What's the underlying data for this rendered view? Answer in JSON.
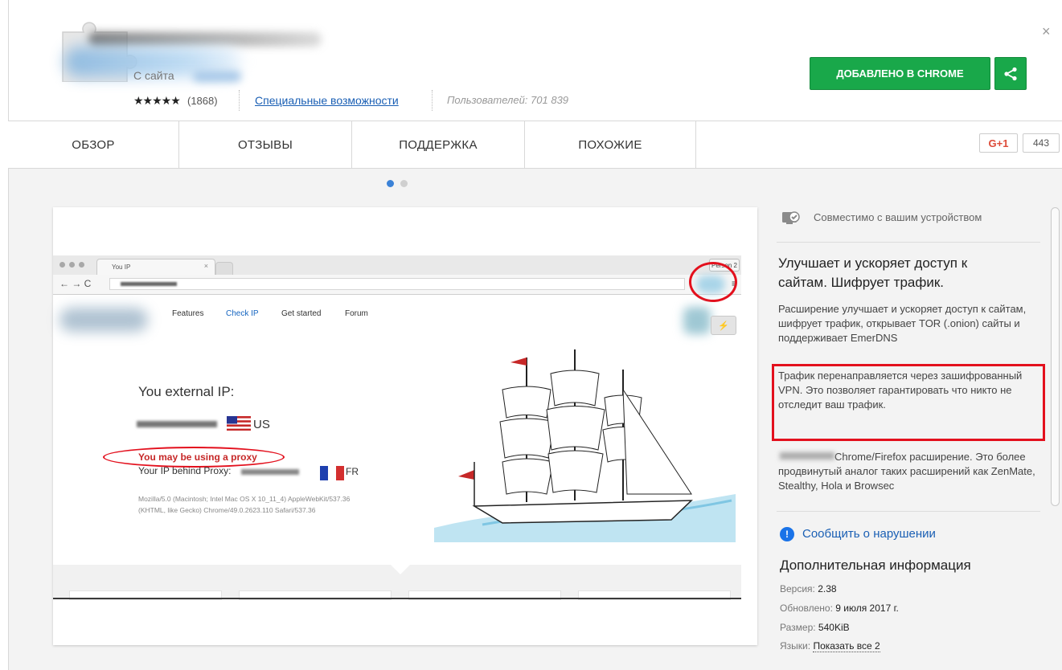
{
  "header": {
    "from_site_label": "С сайта",
    "rating_stars": "★★★★★",
    "rating_count": "(1868)",
    "category_link": "Специальные возможности",
    "users_label": "Пользователей: 701 839",
    "added_button": "ДОБАВЛЕНО В CHROME",
    "close_icon": "×"
  },
  "tabs": [
    {
      "label": "ОБЗОР"
    },
    {
      "label": "ОТЗЫВЫ"
    },
    {
      "label": "ПОДДЕРЖКА"
    },
    {
      "label": "ПОХОЖИЕ"
    }
  ],
  "social": {
    "gplus_label": "G+1",
    "gplus_count": "443"
  },
  "carousel": {
    "active_index": 0,
    "count": 2
  },
  "screenshot": {
    "browser_tab_title": "You IP",
    "browser_profile": "Person 2",
    "site_nav": [
      "Features",
      "Check IP",
      "Get started",
      "Forum"
    ],
    "ip_heading": "You external IP:",
    "country_label": "US",
    "proxy_warning": "You may be using a proxy",
    "proxy_line": "Your IP behind Proxy:",
    "proxy_country": "FR",
    "ua_line_1": "Mozilla/5.0 (Macintosh; Intel Mac OS X 10_11_4) AppleWebKit/537.36",
    "ua_line_2": "(KHTML, like Gecko) Chrome/49.0.2623.110 Safari/537.36",
    "highlight_color": "#e3101d"
  },
  "sidebar": {
    "compat_text": "Совместимо с вашим устройством",
    "heading": "Улучшает и ускоряет доступ к сайтам. Шифрует трафик.",
    "para1": "Расширение улучшает и ускоряет доступ к сайтам, шифрует трафик, открывает TOR (.onion) сайты и поддерживает EmerDNS",
    "para2": "Трафик перенаправляется через зашифрованный VPN. Это позволяет гарантировать что никто не отследит ваш трафик.",
    "para3": "Chrome/Firefox расширение. Это более продвинутый аналог таких расширений как ZenMate, Stealthy, Hola и Browsec",
    "report_link": "Сообщить о нарушении",
    "addinfo_heading": "Дополнительная информация",
    "version_label": "Версия:",
    "version_value": "2.38",
    "updated_label": "Обновлено:",
    "updated_value": "9 июля 2017 г.",
    "size_label": "Размер:",
    "size_value": "540KiB",
    "langs_label": "Языки:",
    "langs_link": "Показать все 2"
  },
  "colors": {
    "accent_green": "#19a84a",
    "link_blue": "#1a5fb4",
    "annotation_red": "#e3101d",
    "active_dot": "#3b82d7"
  }
}
